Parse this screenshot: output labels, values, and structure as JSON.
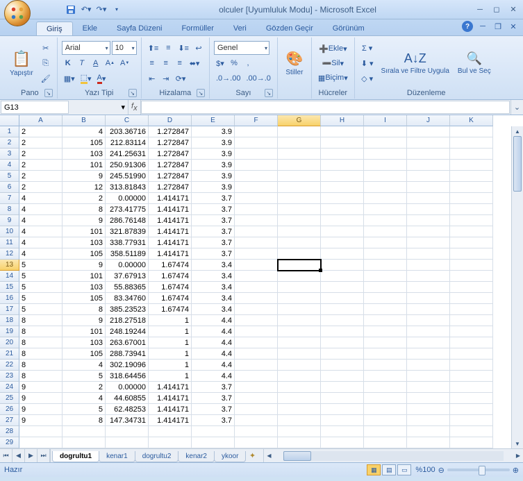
{
  "title": "olculer  [Uyumluluk Modu] - Microsoft Excel",
  "qat": {
    "save": "💾",
    "undo": "↶",
    "redo": "↷"
  },
  "tabs": [
    "Giriş",
    "Ekle",
    "Sayfa Düzeni",
    "Formüller",
    "Veri",
    "Gözden Geçir",
    "Görünüm"
  ],
  "active_tab": "Giriş",
  "clipboard": {
    "paste": "Yapıştır"
  },
  "font": {
    "name": "Arial",
    "size": "10",
    "bold": "K",
    "italic": "T",
    "underline": "A"
  },
  "number_format": "Genel",
  "groups": {
    "pano": "Pano",
    "yazi": "Yazı Tipi",
    "hizalama": "Hizalama",
    "sayi": "Sayı",
    "stiller": "Stiller",
    "hucreler": "Hücreler",
    "duzen": "Düzenleme"
  },
  "cells_grp": {
    "insert": "Ekle",
    "delete": "Sil",
    "format": "Biçim"
  },
  "editing": {
    "sort": "Sırala ve Filtre Uygula",
    "find": "Bul ve Seç"
  },
  "name_box": "G13",
  "formula": "",
  "columns": [
    "A",
    "B",
    "C",
    "D",
    "E",
    "F",
    "G",
    "H",
    "I",
    "J",
    "K"
  ],
  "active_col": "G",
  "active_row": 13,
  "rows": [
    {
      "r": 1,
      "A": "2",
      "B": "4",
      "C": "203.36716",
      "D": "1.272847",
      "E": "3.9"
    },
    {
      "r": 2,
      "A": "2",
      "B": "105",
      "C": "212.83114",
      "D": "1.272847",
      "E": "3.9"
    },
    {
      "r": 3,
      "A": "2",
      "B": "103",
      "C": "241.25631",
      "D": "1.272847",
      "E": "3.9"
    },
    {
      "r": 4,
      "A": "2",
      "B": "101",
      "C": "250.91306",
      "D": "1.272847",
      "E": "3.9"
    },
    {
      "r": 5,
      "A": "2",
      "B": "9",
      "C": "245.51990",
      "D": "1.272847",
      "E": "3.9"
    },
    {
      "r": 6,
      "A": "2",
      "B": "12",
      "C": "313.81843",
      "D": "1.272847",
      "E": "3.9"
    },
    {
      "r": 7,
      "A": "4",
      "B": "2",
      "C": "0.00000",
      "D": "1.414171",
      "E": "3.7"
    },
    {
      "r": 8,
      "A": "4",
      "B": "8",
      "C": "273.41775",
      "D": "1.414171",
      "E": "3.7"
    },
    {
      "r": 9,
      "A": "4",
      "B": "9",
      "C": "286.76148",
      "D": "1.414171",
      "E": "3.7"
    },
    {
      "r": 10,
      "A": "4",
      "B": "101",
      "C": "321.87839",
      "D": "1.414171",
      "E": "3.7"
    },
    {
      "r": 11,
      "A": "4",
      "B": "103",
      "C": "338.77931",
      "D": "1.414171",
      "E": "3.7"
    },
    {
      "r": 12,
      "A": "4",
      "B": "105",
      "C": "358.51189",
      "D": "1.414171",
      "E": "3.7"
    },
    {
      "r": 13,
      "A": "5",
      "B": "9",
      "C": "0.00000",
      "D": "1.67474",
      "E": "3.4"
    },
    {
      "r": 14,
      "A": "5",
      "B": "101",
      "C": "37.67913",
      "D": "1.67474",
      "E": "3.4"
    },
    {
      "r": 15,
      "A": "5",
      "B": "103",
      "C": "55.88365",
      "D": "1.67474",
      "E": "3.4"
    },
    {
      "r": 16,
      "A": "5",
      "B": "105",
      "C": "83.34760",
      "D": "1.67474",
      "E": "3.4"
    },
    {
      "r": 17,
      "A": "5",
      "B": "8",
      "C": "385.23523",
      "D": "1.67474",
      "E": "3.4"
    },
    {
      "r": 18,
      "A": "8",
      "B": "9",
      "C": "218.27518",
      "D": "1",
      "E": "4.4"
    },
    {
      "r": 19,
      "A": "8",
      "B": "101",
      "C": "248.19244",
      "D": "1",
      "E": "4.4"
    },
    {
      "r": 20,
      "A": "8",
      "B": "103",
      "C": "263.67001",
      "D": "1",
      "E": "4.4"
    },
    {
      "r": 21,
      "A": "8",
      "B": "105",
      "C": "288.73941",
      "D": "1",
      "E": "4.4"
    },
    {
      "r": 22,
      "A": "8",
      "B": "4",
      "C": "302.19096",
      "D": "1",
      "E": "4.4"
    },
    {
      "r": 23,
      "A": "8",
      "B": "5",
      "C": "318.64456",
      "D": "1",
      "E": "4.4"
    },
    {
      "r": 24,
      "A": "9",
      "B": "2",
      "C": "0.00000",
      "D": "1.414171",
      "E": "3.7"
    },
    {
      "r": 25,
      "A": "9",
      "B": "4",
      "C": "44.60855",
      "D": "1.414171",
      "E": "3.7"
    },
    {
      "r": 26,
      "A": "9",
      "B": "5",
      "C": "62.48253",
      "D": "1.414171",
      "E": "3.7"
    },
    {
      "r": 27,
      "A": "9",
      "B": "8",
      "C": "147.34731",
      "D": "1.414171",
      "E": "3.7"
    }
  ],
  "sheets": [
    "dogrultu1",
    "kenar1",
    "dogrultu2",
    "kenar2",
    "ykoor"
  ],
  "active_sheet": "dogrultu1",
  "status_text": "Hazır",
  "zoom": "%100"
}
